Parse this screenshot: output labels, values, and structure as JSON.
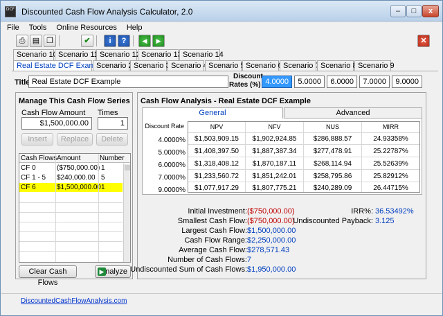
{
  "window": {
    "title": "Discounted Cash Flow Analysis Calculator, 2.0",
    "icon_text": "DCF",
    "min_label": "–",
    "max_label": "□",
    "close_label": "x"
  },
  "menu": [
    "File",
    "Tools",
    "Online Resources",
    "Help"
  ],
  "toolbar": {
    "icons": [
      "print-icon",
      "print-preview-icon",
      "copy-icon",
      "check-icon",
      "info-icon",
      "help-icon",
      "back-arrow-icon",
      "forward-arrow-icon",
      "exit-icon"
    ],
    "glyphs": {
      "print": "⎙",
      "preview": "▤",
      "copy": "❐",
      "check": "✔",
      "info": "i",
      "help": "?",
      "back": "◀",
      "forward": "▶",
      "exit": "✕"
    }
  },
  "scenario_tabs_row1": [
    "Scenario 10",
    "Scenario 11",
    "Scenario 12",
    "Scenario 13",
    "Scenario 14"
  ],
  "scenario_tabs_row2": [
    "Real Estate DCF Exam ...",
    "Scenario 2",
    "Scenario 3",
    "Scenario 4",
    "Scenario 5",
    "Scenario 6",
    "Scenario 7",
    "Scenario 8",
    "Scenario 9"
  ],
  "title_field": {
    "label": "Title",
    "value": "Real Estate DCF Example"
  },
  "discount_rates": {
    "label_line1": "Discount",
    "label_line2": "Rates (%)",
    "values": [
      "4.0000",
      "5.0000",
      "6.0000",
      "7.0000",
      "9.0000"
    ]
  },
  "series_panel": {
    "heading": "Manage This Cash Flow Series",
    "amount_label": "Cash Flow Amount",
    "amount_value": "$1,500,000.00",
    "times_label": "Times",
    "times_value": "1",
    "insert_label": "Insert",
    "replace_label": "Replace",
    "delete_label": "Delete",
    "columns": [
      "Cash Flows",
      "Amount",
      "Number"
    ],
    "rows": [
      {
        "name": "CF 0",
        "amount": "($750,000.00)",
        "number": "1"
      },
      {
        "name": "CF 1 - 5",
        "amount": "$240,000.00",
        "number": "5"
      },
      {
        "name": "CF 6",
        "amount": "$1,500,000.00",
        "number": "1"
      }
    ],
    "clear_label": "Clear Cash Flows",
    "analyze_label": "Analyze"
  },
  "analysis": {
    "heading": "Cash Flow Analysis - Real Estate DCF Example",
    "tab_general": "General",
    "tab_advanced": "Advanced",
    "rate_header": "Discount Rate",
    "columns": [
      "NPV",
      "NFV",
      "NUS",
      "MIRR"
    ],
    "rows": [
      {
        "rate": "4.0000%",
        "npv": "$1,503,909.15",
        "nfv": "$1,902,924.85",
        "nus": "$286,888.57",
        "mirr": "24.93358%"
      },
      {
        "rate": "5.0000%",
        "npv": "$1,408,397.50",
        "nfv": "$1,887,387.34",
        "nus": "$277,478.91",
        "mirr": "25.22787%"
      },
      {
        "rate": "6.0000%",
        "npv": "$1,318,408.12",
        "nfv": "$1,870,187.11",
        "nus": "$268,114.94",
        "mirr": "25.52639%"
      },
      {
        "rate": "7.0000%",
        "npv": "$1,233,560.72",
        "nfv": "$1,851,242.01",
        "nus": "$258,795.86",
        "mirr": "25.82912%"
      },
      {
        "rate": "9.0000%",
        "npv": "$1,077,917.29",
        "nfv": "$1,807,775.21",
        "nus": "$240,289.09",
        "mirr": "26.44715%"
      }
    ]
  },
  "summary": [
    {
      "label": "Initial Investment:",
      "value": "($750,000.00)",
      "color": "#c00000"
    },
    {
      "label": "Smallest Cash Flow:",
      "value": "($750,000.00)",
      "color": "#c00000"
    },
    {
      "label": "Largest Cash Flow:",
      "value": "$1,500,000.00",
      "color": "#003fbf"
    },
    {
      "label": "Cash Flow Range:",
      "value": "$2,250,000.00",
      "color": "#003fbf"
    },
    {
      "label": "Average Cash Flow:",
      "value": "$278,571.43",
      "color": "#003fbf"
    },
    {
      "label": "Number of Cash Flows:",
      "value": "7",
      "color": "#003fbf"
    },
    {
      "label": "Undiscounted Sum of Cash Flows:",
      "value": "$1,950,000.00",
      "color": "#003fbf"
    }
  ],
  "summary_right": [
    {
      "label": "IRR%:",
      "value": "36.53492%"
    },
    {
      "label": "Undiscounted Payback:",
      "value": "3.125"
    }
  ],
  "footer": {
    "link": "DiscountedCashFlowAnalysis.com"
  },
  "colors": {
    "highlight_row": "#ffff00",
    "negative": "#c00000",
    "positive": "#003fbf",
    "link": "#0033cc"
  }
}
